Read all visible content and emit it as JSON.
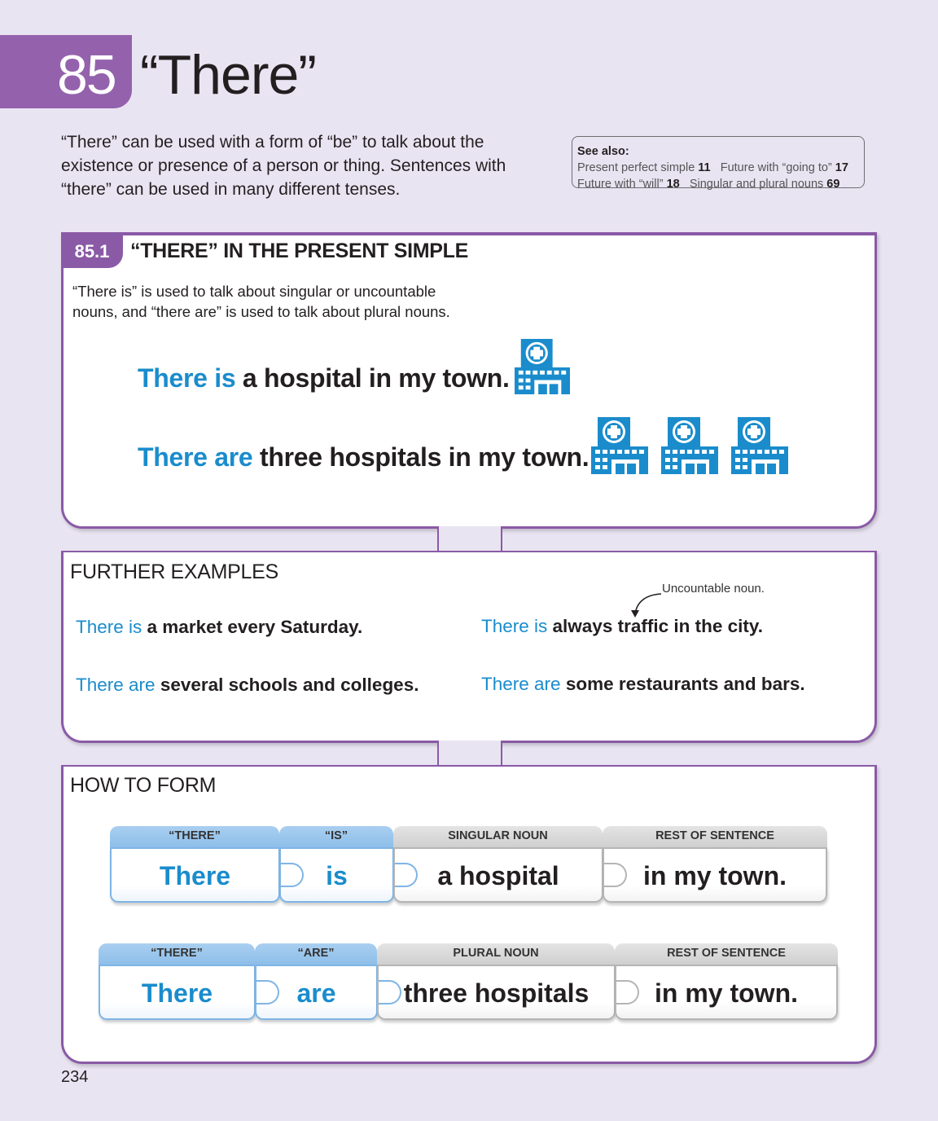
{
  "header": {
    "unit_number": "85",
    "title": "“There”"
  },
  "intro": "“There” can be used with a form of “be” to talk about the existence or presence of a person or thing. Sentences with “there” can be used in many different tenses.",
  "see_also": {
    "heading": "See also:",
    "row1": [
      {
        "label": "Present perfect simple",
        "num": "11"
      },
      {
        "label": "Future with “going to”",
        "num": "17"
      }
    ],
    "row2": [
      {
        "label": "Future with “will”",
        "num": "18"
      },
      {
        "label": "Singular and plural nouns",
        "num": "69"
      }
    ]
  },
  "section": {
    "number": "85.1",
    "title": "“THERE” IN THE PRESENT SIMPLE",
    "description": "“There is” is used to talk about singular or uncountable nouns, and “there are” is used to talk about plural nouns.",
    "example1": {
      "hl": "There is",
      "rest": " a hospital in my town."
    },
    "example2": {
      "hl": "There are",
      "rest": " three hospitals in my town."
    },
    "icon": "hospital-icon",
    "color_highlight": "#1a8ccc",
    "color_accent": "#8a5aa6"
  },
  "further": {
    "heading": "FURTHER EXAMPLES",
    "note": "Uncountable noun.",
    "examples": [
      {
        "hl": "There is",
        "rest": " a market every Saturday."
      },
      {
        "hl": "There is",
        "rest": " always traffic in the city."
      },
      {
        "hl": "There are",
        "rest": " several schools and colleges."
      },
      {
        "hl": "There are",
        "rest": " some restaurants and bars."
      }
    ]
  },
  "howto": {
    "heading": "HOW TO FORM",
    "row1": [
      {
        "head": "“THERE”",
        "text": "There"
      },
      {
        "head": "“IS”",
        "text": "is"
      },
      {
        "head": "SINGULAR NOUN",
        "text": "a hospital"
      },
      {
        "head": "REST OF SENTENCE",
        "text": "in my town."
      }
    ],
    "row2": [
      {
        "head": "“THERE”",
        "text": "There"
      },
      {
        "head": "“ARE”",
        "text": "are"
      },
      {
        "head": "PLURAL NOUN",
        "text": "three hospitals"
      },
      {
        "head": "REST OF SENTENCE",
        "text": "in my town."
      }
    ]
  },
  "page_number": "234"
}
